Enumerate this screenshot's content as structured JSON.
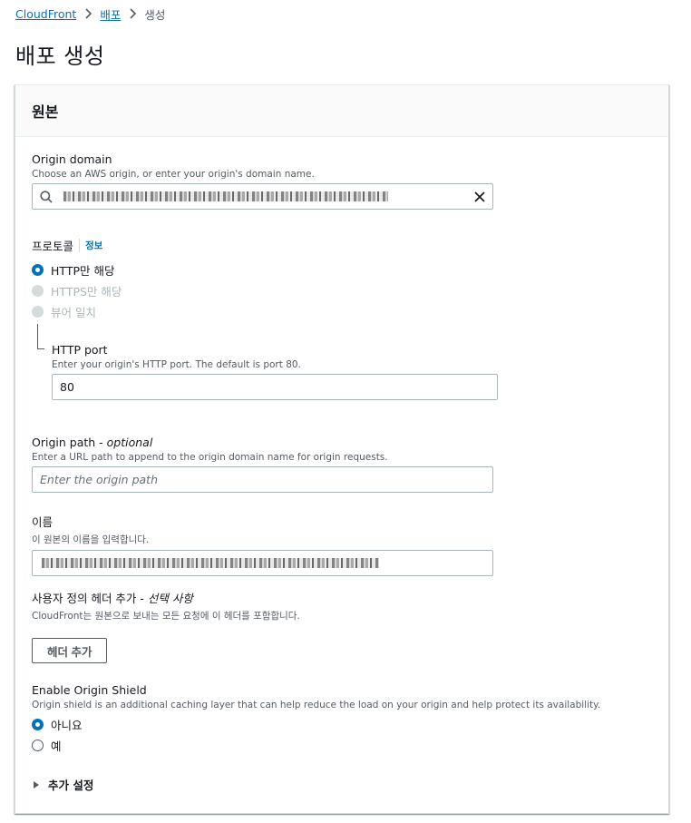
{
  "breadcrumb": {
    "items": [
      "CloudFront",
      "배포"
    ],
    "current": "생성"
  },
  "page": {
    "title": "배포 생성"
  },
  "panel": {
    "title": "원본"
  },
  "origin_domain": {
    "label": "Origin domain",
    "description": "Choose an AWS origin, or enter your origin's domain name."
  },
  "protocol": {
    "label": "프로토콜",
    "info": "정보",
    "options": [
      {
        "label": "HTTP만 해당",
        "selected": true,
        "disabled": false
      },
      {
        "label": "HTTPS만 해당",
        "selected": false,
        "disabled": true
      },
      {
        "label": "뷰어 일치",
        "selected": false,
        "disabled": true
      }
    ]
  },
  "http_port": {
    "label": "HTTP port",
    "description": "Enter your origin's HTTP port. The default is port 80.",
    "value": "80"
  },
  "origin_path": {
    "label": "Origin path - ",
    "label_optional": "optional",
    "description": "Enter a URL path to append to the origin domain name for origin requests.",
    "placeholder": "Enter the origin path"
  },
  "name": {
    "label": "이름",
    "description": "이 원본의 이름을 입력합니다."
  },
  "custom_headers": {
    "label": "사용자 정의 헤더 추가 - ",
    "label_optional": "선택 사항",
    "description": "CloudFront는 원본으로 보내는 모든 요청에 이 헤더를 포함합니다.",
    "button": "헤더 추가"
  },
  "origin_shield": {
    "label": "Enable Origin Shield",
    "description": "Origin shield is an additional caching layer that can help reduce the load on your origin and help protect its availability.",
    "options": [
      {
        "label": "아니요",
        "selected": true
      },
      {
        "label": "예",
        "selected": false
      }
    ]
  },
  "additional_settings": {
    "label": "추가 설정"
  },
  "colors": {
    "link": "#0073bb",
    "text": "#16191f",
    "muted": "#545b64",
    "border": "#aab7b8"
  }
}
